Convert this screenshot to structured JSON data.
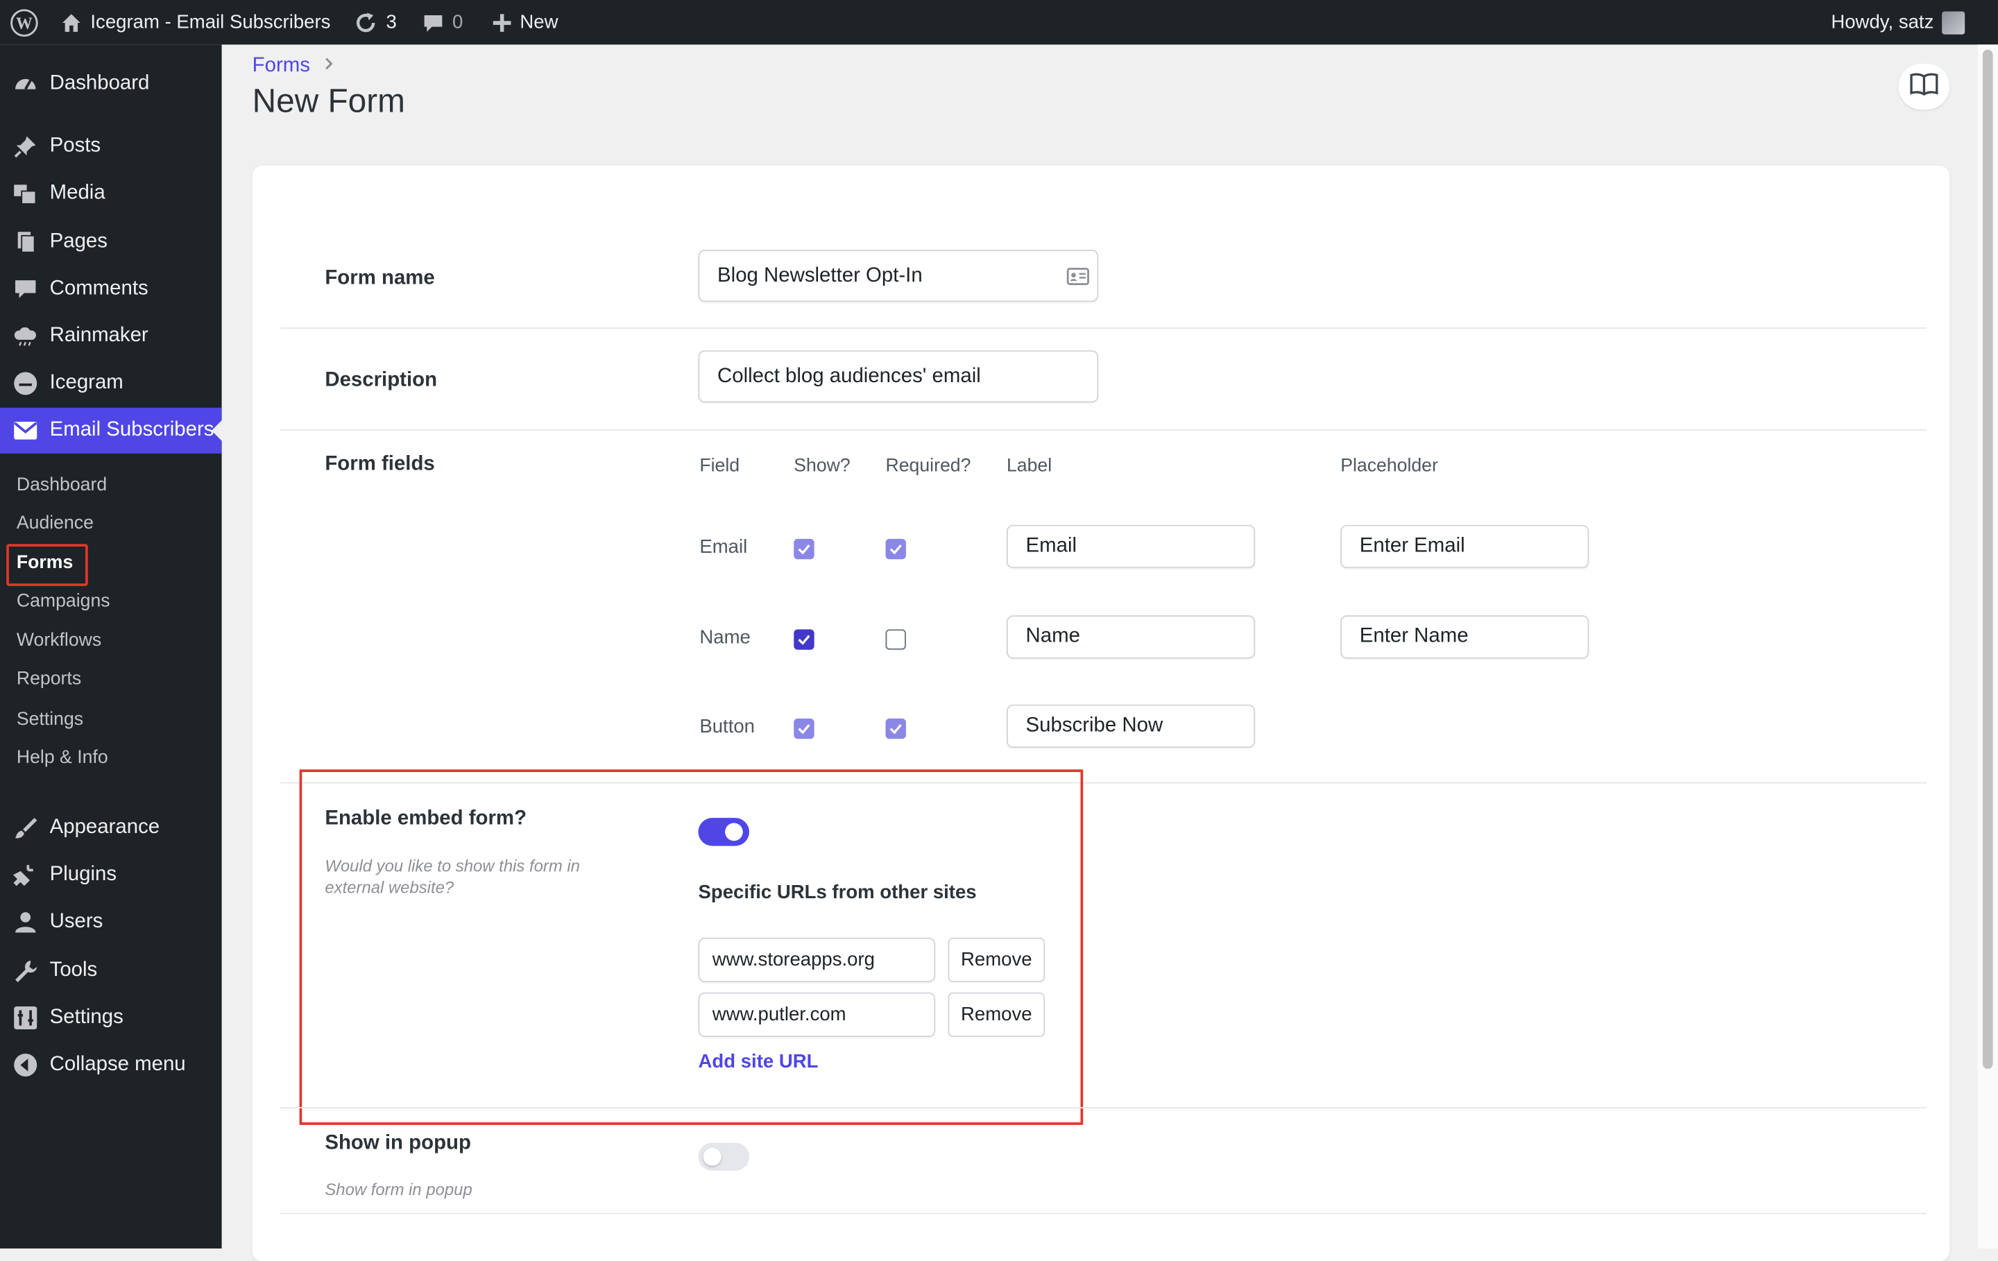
{
  "admin_bar": {
    "site_title": "Icegram - Email Subscribers",
    "updates_count": "3",
    "comments_count": "0",
    "new_label": "New",
    "greeting": "Howdy, satz"
  },
  "sidebar": {
    "menu": [
      {
        "label": "Dashboard",
        "icon": "dashboard-icon"
      },
      {
        "label": "Posts",
        "icon": "pin-icon"
      },
      {
        "label": "Media",
        "icon": "media-icon"
      },
      {
        "label": "Pages",
        "icon": "pages-icon"
      },
      {
        "label": "Comments",
        "icon": "comment-icon"
      },
      {
        "label": "Rainmaker",
        "icon": "cloud-icon"
      },
      {
        "label": "Icegram",
        "icon": "icegram-icon"
      },
      {
        "label": "Email Subscribers",
        "icon": "email-icon"
      }
    ],
    "submenu": [
      "Dashboard",
      "Audience",
      "Forms",
      "Campaigns",
      "Workflows",
      "Reports",
      "Settings",
      "Help & Info"
    ],
    "menu_bottom": [
      {
        "label": "Appearance",
        "icon": "brush-icon"
      },
      {
        "label": "Plugins",
        "icon": "plugin-icon"
      },
      {
        "label": "Users",
        "icon": "user-icon"
      },
      {
        "label": "Tools",
        "icon": "wrench-icon"
      },
      {
        "label": "Settings",
        "icon": "settings-icon"
      },
      {
        "label": "Collapse menu",
        "icon": "collapse-icon"
      }
    ]
  },
  "page": {
    "breadcrumb": "Forms",
    "title": "New Form"
  },
  "form": {
    "name_label": "Form name",
    "name_value": "Blog Newsletter Opt-In",
    "description_label": "Description",
    "description_value": "Collect blog audiences' email",
    "fields_label": "Form fields",
    "columns": [
      "Field",
      "Show?",
      "Required?",
      "Label",
      "Placeholder"
    ],
    "fields": [
      {
        "field": "Email",
        "show": true,
        "required": true,
        "label": "Email",
        "placeholder": "Enter Email"
      },
      {
        "field": "Name",
        "show": true,
        "required": false,
        "label": "Name",
        "placeholder": "Enter Name"
      },
      {
        "field": "Button",
        "show": true,
        "required": true,
        "label": "Subscribe Now"
      }
    ],
    "embed": {
      "label": "Enable embed form?",
      "help": "Would you like to show this form in external website?",
      "enabled": true,
      "urls_heading": "Specific URLs from other sites",
      "urls": [
        "www.storeapps.org",
        "www.putler.com"
      ],
      "remove_label": "Remove",
      "add_label": "Add site URL"
    },
    "popup": {
      "label": "Show in popup",
      "help": "Show form in popup",
      "enabled": false
    }
  },
  "colors": {
    "accent": "#4f46e5",
    "highlight": "#e2362a",
    "admin_bg": "#1d2327"
  }
}
